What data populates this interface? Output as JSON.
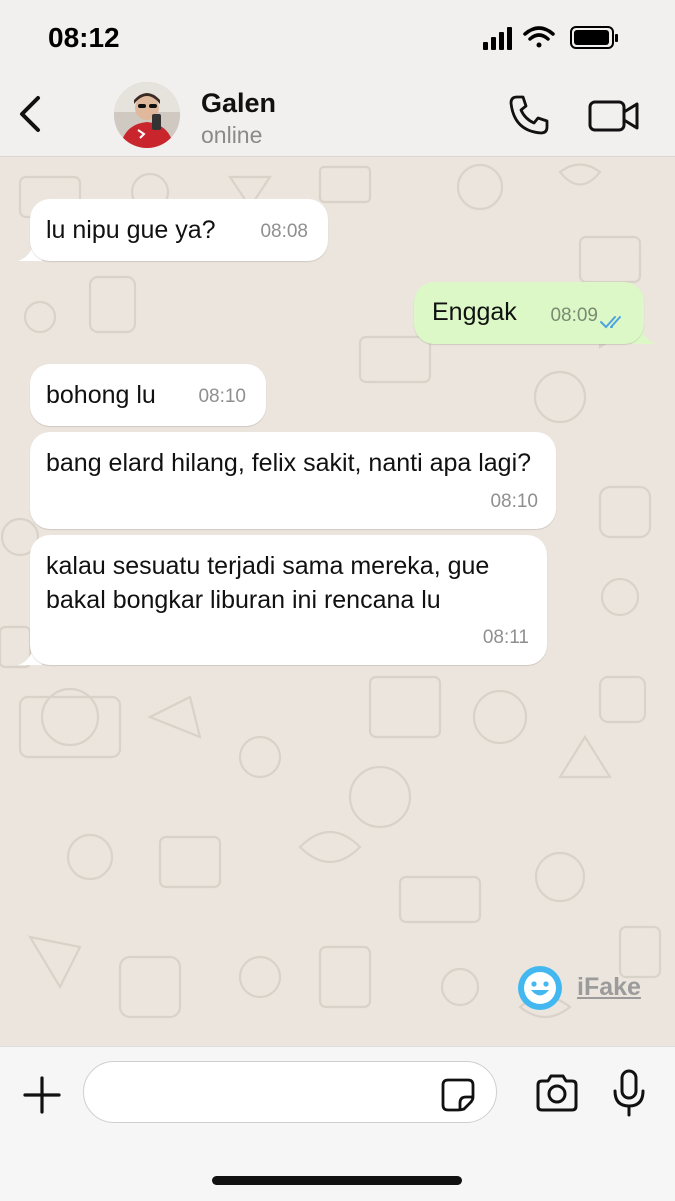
{
  "status_bar": {
    "time": "08:12"
  },
  "header": {
    "contact_name": "Galen",
    "contact_status": "online"
  },
  "messages": [
    {
      "direction": "incoming",
      "text": "lu nipu gue ya?",
      "time": "08:08"
    },
    {
      "direction": "outgoing",
      "text": "Enggak",
      "time": "08:09",
      "read": true
    },
    {
      "direction": "incoming",
      "text": "bohong lu",
      "time": "08:10"
    },
    {
      "direction": "incoming",
      "text": "bang elard hilang, felix sakit, nanti apa lagi?",
      "time": "08:10"
    },
    {
      "direction": "incoming",
      "text": "kalau sesuatu terjadi sama mereka, gue bakal bongkar liburan ini rencana lu",
      "time": "08:11"
    }
  ],
  "watermark": {
    "label": "iFake"
  },
  "input_bar": {
    "value": "",
    "placeholder": ""
  },
  "colors": {
    "incoming_bubble": "#FFFFFF",
    "outgoing_bubble": "#DCF8C6",
    "read_ticks": "#4FA3E0",
    "chat_background": "#ECE5DD"
  },
  "icons": [
    "back-icon",
    "call-icon",
    "video-call-icon",
    "double-check-icon",
    "ifake-logo-icon",
    "plus-icon",
    "sticker-icon",
    "camera-icon",
    "microphone-icon"
  ]
}
